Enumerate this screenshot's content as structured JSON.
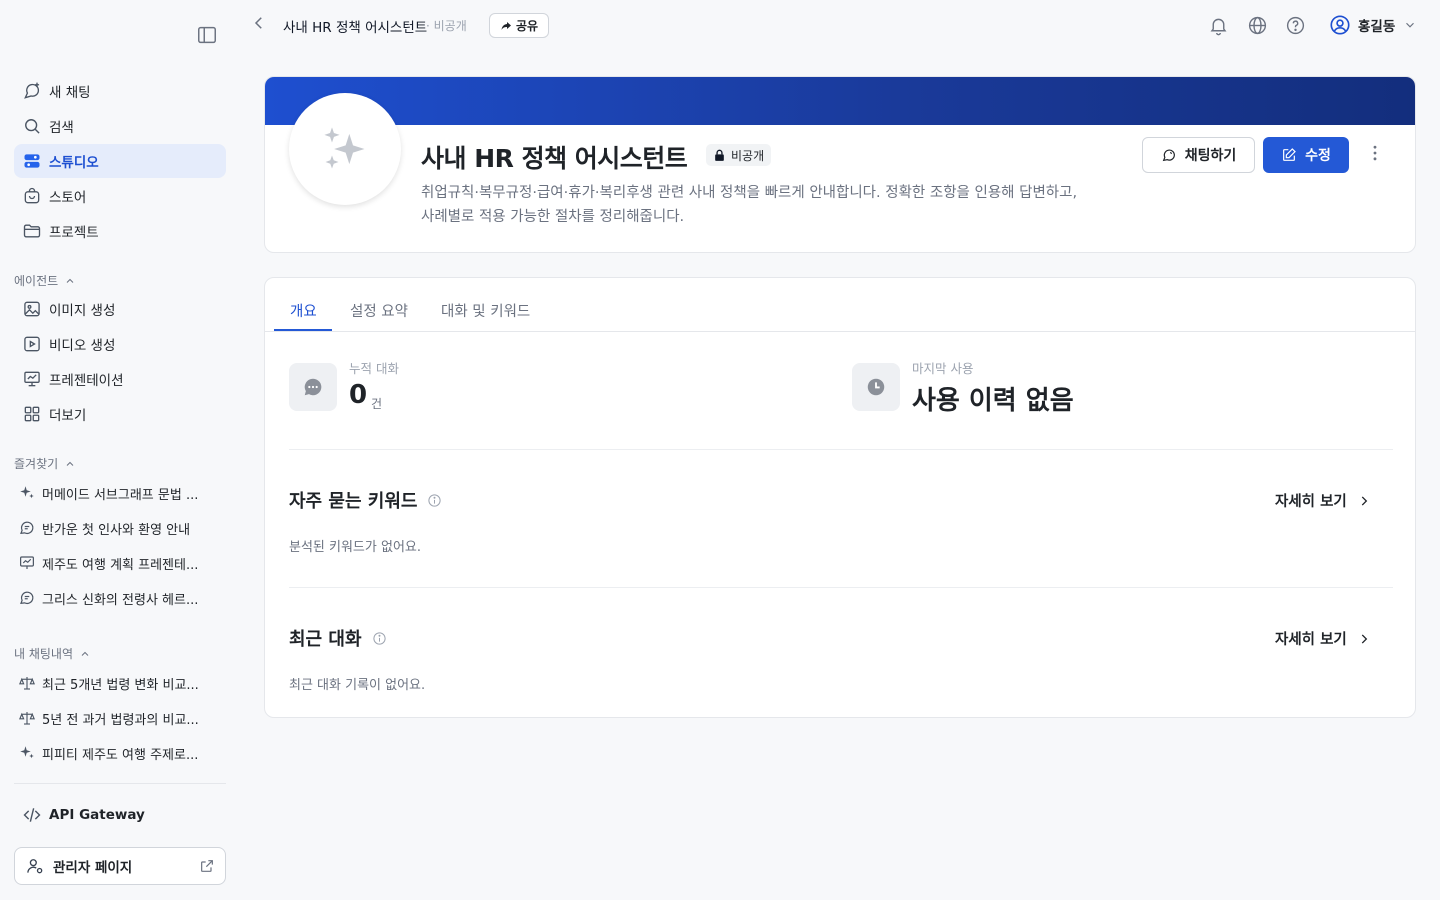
{
  "sidebar": {
    "nav": [
      {
        "label": "새 채팅",
        "icon": "new-chat-icon"
      },
      {
        "label": "검색",
        "icon": "search-icon"
      },
      {
        "label": "스튜디오",
        "icon": "studio-icon",
        "active": true
      },
      {
        "label": "스토어",
        "icon": "store-bag-icon"
      },
      {
        "label": "프로젝트",
        "icon": "folder-icon"
      }
    ],
    "agents_label": "에이전트",
    "agents": [
      {
        "label": "이미지 생성",
        "icon": "image-icon"
      },
      {
        "label": "비디오 생성",
        "icon": "video-icon"
      },
      {
        "label": "프레젠테이션",
        "icon": "presentation-icon"
      },
      {
        "label": "더보기",
        "icon": "grid-icon"
      }
    ],
    "favorites_label": "즐겨찾기",
    "favorites": [
      {
        "label": "머메이드 서브그래프 문법 ...",
        "icon": "sparkle-icon"
      },
      {
        "label": "반가운 첫 인사와 환영 안내",
        "icon": "chat-bubble-icon"
      },
      {
        "label": "제주도 여행 계획 프레젠테...",
        "icon": "presentation-icon"
      },
      {
        "label": "그리스 신화의 전령사 헤르...",
        "icon": "chat-bubble-icon"
      }
    ],
    "history_label": "내 채팅내역",
    "history": [
      {
        "label": "최근 5개년 법령 변화 비교...",
        "icon": "scale-icon"
      },
      {
        "label": "5년 전 과거 법령과의 비교...",
        "icon": "scale-icon"
      },
      {
        "label": "피피티 제주도 여행 주제로...",
        "icon": "sparkle-icon"
      }
    ],
    "api_label": "API Gateway",
    "admin_label": "관리자 페이지"
  },
  "topbar": {
    "title": "사내 HR 정책 어시스턴트",
    "visibility": "· 비공개",
    "share_label": "공유",
    "user_name": "홍길동"
  },
  "profile": {
    "name": "사내 HR 정책 어시스턴트",
    "badge": "비공개",
    "description_line1": "취업규칙·복무규정·급여·휴가·복리후생 관련 사내 정책을 빠르게 안내합니다. 정확한 조항을 인용해 답변하고,",
    "description_line2": "사례별로 적용 가능한 절차를 정리해줍니다.",
    "chat_button": "채팅하기",
    "edit_button": "수정"
  },
  "tabs": [
    "개요",
    "설정 요약",
    "대화 및 키워드"
  ],
  "stats": {
    "total_label": "누적 대화",
    "total_value": "0",
    "total_unit": "건",
    "last_label": "마지막 사용",
    "last_value": "사용 이력 없음"
  },
  "keywords": {
    "title": "자주 묻는 키워드",
    "more": "자세히 보기",
    "empty": "분석된 키워드가 없어요."
  },
  "recent": {
    "title": "최근 대화",
    "more": "자세히 보기",
    "empty": "최근 대화 기록이 없어요."
  },
  "colors": {
    "accent": "#2459d6",
    "banner_start": "#1e4fd0",
    "banner_end": "#132e7d",
    "active_bg": "#e5ecfb"
  }
}
